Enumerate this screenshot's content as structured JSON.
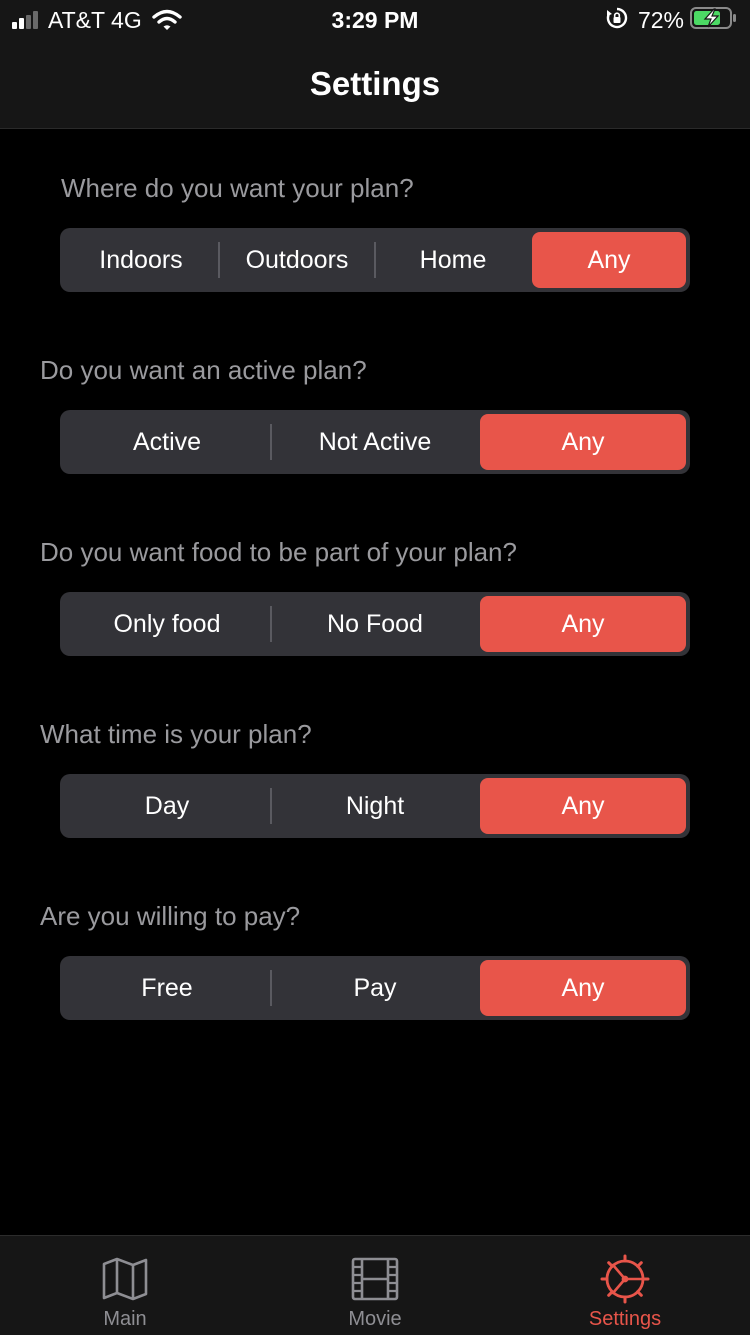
{
  "status_bar": {
    "carrier": "AT&T 4G",
    "time": "3:29 PM",
    "battery": "72%",
    "icons": [
      "signal-icon",
      "wifi-icon",
      "rotation-lock-icon",
      "battery-charging-icon"
    ]
  },
  "nav": {
    "title": "Settings"
  },
  "sections": [
    {
      "question": "Where do you want your plan?",
      "options": [
        "Indoors",
        "Outdoors",
        "Home",
        "Any"
      ],
      "selected": "Any"
    },
    {
      "question": "Do you want an active plan?",
      "options": [
        "Active",
        "Not Active",
        "Any"
      ],
      "selected": "Any"
    },
    {
      "question": "Do you want food to be part of your plan?",
      "options": [
        "Only food",
        "No Food",
        "Any"
      ],
      "selected": "Any"
    },
    {
      "question": "What time is your plan?",
      "options": [
        "Day",
        "Night",
        "Any"
      ],
      "selected": "Any"
    },
    {
      "question": "Are you willing to pay?",
      "options": [
        "Free",
        "Pay",
        "Any"
      ],
      "selected": "Any"
    }
  ],
  "tab_bar": {
    "tabs": [
      {
        "label": "Main",
        "icon": "map-icon",
        "active": false
      },
      {
        "label": "Movie",
        "icon": "film-icon",
        "active": false
      },
      {
        "label": "Settings",
        "icon": "settings-wheel-icon",
        "active": true
      }
    ]
  },
  "colors": {
    "accent": "#e8554a",
    "segment_background": "#333338",
    "question_text": "#9a9a9e",
    "inactive_tab": "#8e8e93",
    "background": "#000000"
  }
}
